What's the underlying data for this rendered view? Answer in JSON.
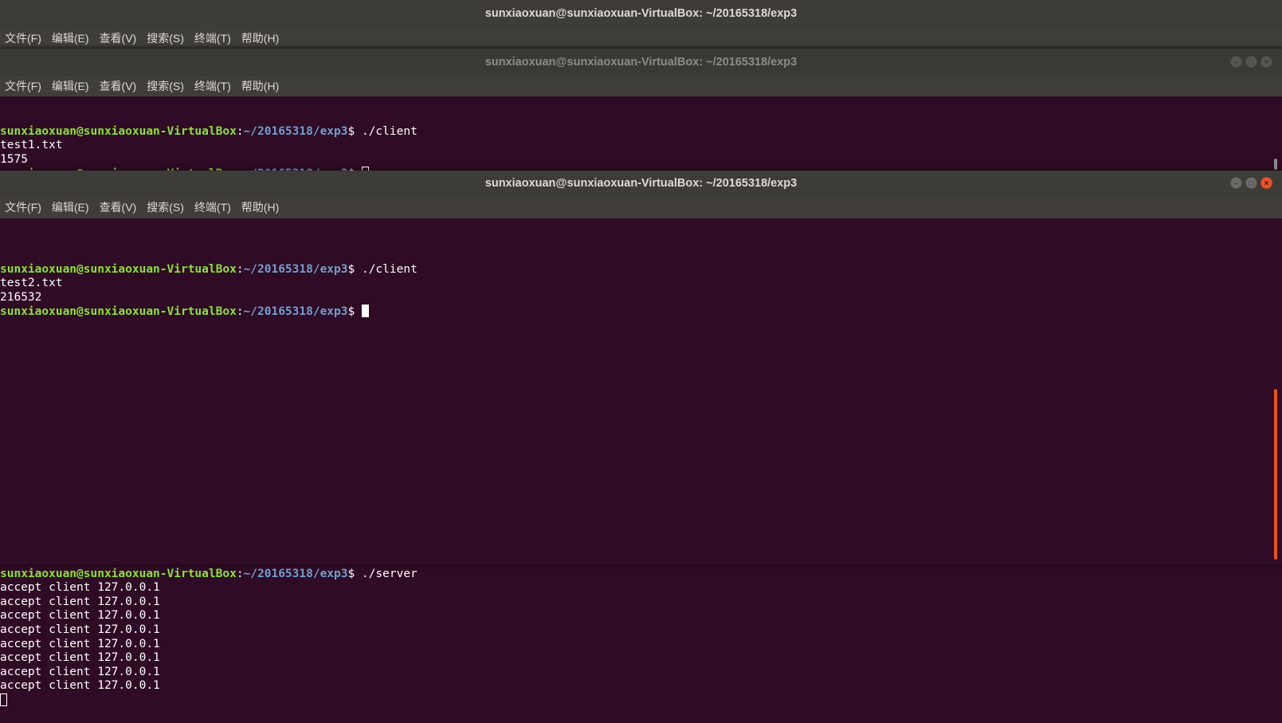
{
  "prompt": {
    "user_host": "sunxiaoxuan@sunxiaoxuan-VirtualBox",
    "colon": ":",
    "path": "~/20165318/exp3",
    "dollar": "$ "
  },
  "windows": {
    "back": {
      "title": "sunxiaoxuan@sunxiaoxuan-VirtualBox: ~/20165318/exp3",
      "menu": [
        "文件(F)",
        "编辑(E)",
        "查看(V)",
        "搜索(S)",
        "终端(T)",
        "帮助(H)"
      ],
      "command": "./server",
      "output": [
        "accept client 127.0.0.1",
        "accept client 127.0.0.1",
        "accept client 127.0.0.1",
        "accept client 127.0.0.1",
        "accept client 127.0.0.1",
        "accept client 127.0.0.1",
        "accept client 127.0.0.1",
        "accept client 127.0.0.1"
      ]
    },
    "middle": {
      "title": "sunxiaoxuan@sunxiaoxuan-VirtualBox: ~/20165318/exp3",
      "menu": [
        "文件(F)",
        "编辑(E)",
        "查看(V)",
        "搜索(S)",
        "终端(T)",
        "帮助(H)"
      ],
      "command": "./client",
      "output": [
        "test1.txt",
        "1575"
      ]
    },
    "front": {
      "title": "sunxiaoxuan@sunxiaoxuan-VirtualBox: ~/20165318/exp3",
      "menu": [
        "文件(F)",
        "编辑(E)",
        "查看(V)",
        "搜索(S)",
        "终端(T)",
        "帮助(H)"
      ],
      "command": "./client",
      "output": [
        "test2.txt",
        "216532"
      ]
    }
  },
  "colors": {
    "terminal_bg": "#2f0b25",
    "prompt_user": "#8ae234",
    "prompt_path": "#729fcf",
    "accent": "#e95420"
  },
  "icons": [
    "minimize-icon",
    "maximize-icon",
    "close-icon"
  ]
}
